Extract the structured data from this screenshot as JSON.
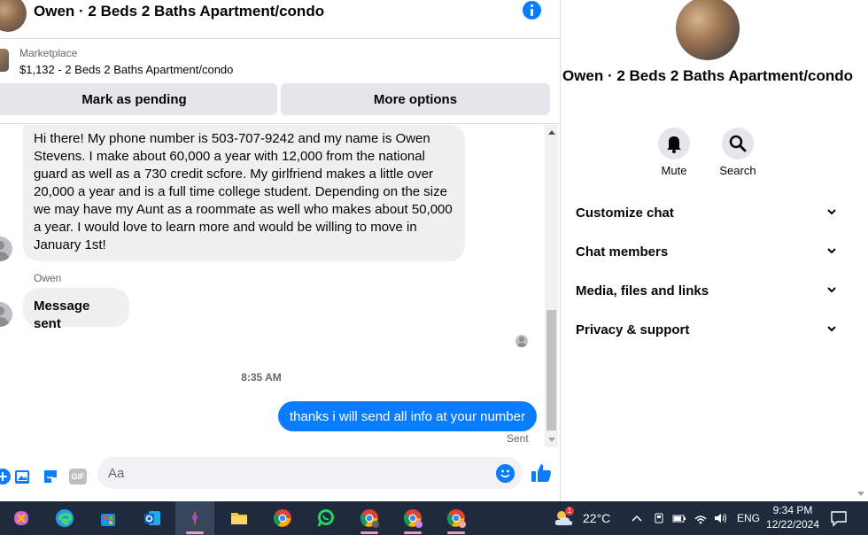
{
  "header": {
    "title": "Owen · 2 Beds 2 Baths Apartment/condo"
  },
  "marketplace": {
    "source": "Marketplace",
    "listing": "$1,132 - 2 Beds 2 Baths Apartment/condo",
    "mark_pending_label": "Mark as pending",
    "more_options_label": "More options"
  },
  "messages": {
    "first": "Hi there! My phone number is 503-707-9242 and my name is Owen Stevens. I make about 60,000 a year with 12,000 from the national guard as well as a 730 credit scfore. My girlfriend makes a little over 20,000 a year and is a full time college student. Depending on the size we may have my Aunt as a roommate as well who makes about 50,000 a year. I would love to learn more and would be willing to move in January 1st!",
    "sender": "Owen",
    "second": "Message sent",
    "timestamp": "8:35 AM",
    "outgoing": "thanks i will send all info at your number",
    "status": "Sent"
  },
  "composer": {
    "placeholder": "Aa",
    "gif_label": "GIF"
  },
  "info_panel": {
    "title": "Owen · 2 Beds 2 Baths Apartment/condo",
    "mute_label": "Mute",
    "search_label": "Search",
    "sections": [
      "Customize chat",
      "Chat members",
      "Media, files and links",
      "Privacy & support"
    ]
  },
  "taskbar": {
    "temperature": "22°C",
    "language": "ENG",
    "time": "9:34 PM",
    "date": "12/22/2024",
    "weather_badge": "1"
  },
  "colors": {
    "messenger_blue": "#0a7cff",
    "taskbar_bg": "#1f2b3d",
    "bubble_gray": "#f0f0f0"
  }
}
